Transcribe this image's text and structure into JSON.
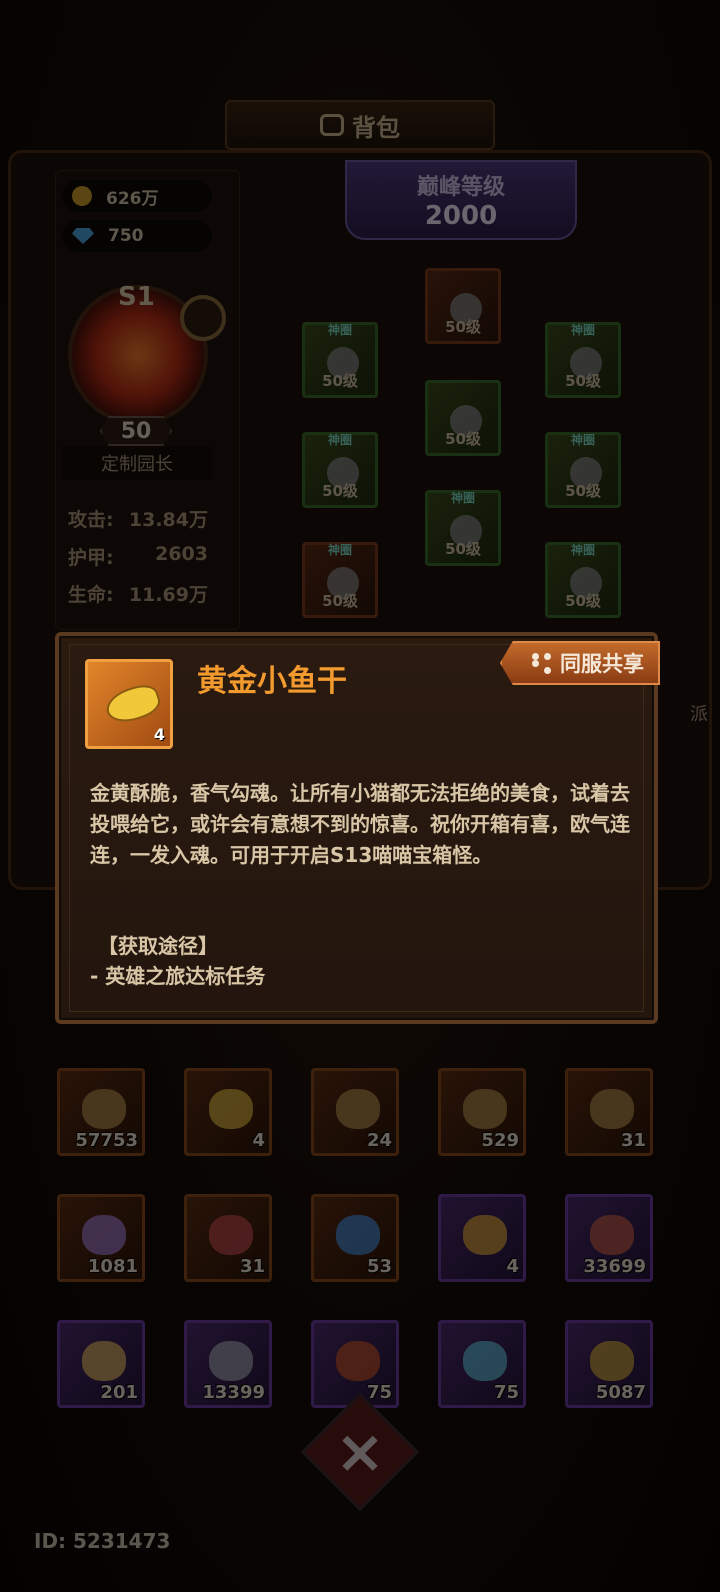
{
  "header": {
    "title": "背包"
  },
  "resources": {
    "gold": "626万",
    "gems": "750"
  },
  "profile": {
    "season": "S1",
    "level": "50",
    "title": "定制园长"
  },
  "stats": [
    {
      "label": "攻击:",
      "value": "13.84万"
    },
    {
      "label": "护甲:",
      "value": "2603"
    },
    {
      "label": "生命:",
      "value": "11.69万"
    }
  ],
  "peak": {
    "label": "巅峰等级",
    "value": "2000"
  },
  "equipment": {
    "tag": "神圈",
    "level_text": "50级"
  },
  "side_partial_label": "派",
  "inventory_row1": [
    "57753",
    "4",
    "24",
    "529",
    "31"
  ],
  "inventory_row2": [
    "1081",
    "31",
    "53",
    "4",
    "33699"
  ],
  "inventory_row3": [
    "201",
    "13399",
    "75",
    "75",
    "5087"
  ],
  "popup": {
    "item_name": "黄金小鱼干",
    "item_count": "4",
    "share_label": "同服共享",
    "description": "金黄酥脆，香气勾魂。让所有小猫都无法拒绝的美食，试着去投喂给它，或许会有意想不到的惊喜。祝你开箱有喜，欧气连连，一发入魂。可用于开启S13喵喵宝箱怪。",
    "source_title": "【获取途径】",
    "source_item": "- 英雄之旅达标任务"
  },
  "footer": {
    "player_id": "ID: 5231473"
  },
  "colors": {
    "accent": "#f29a2e",
    "popup_bg": "#2a1a10",
    "share": "#c26a2a"
  }
}
